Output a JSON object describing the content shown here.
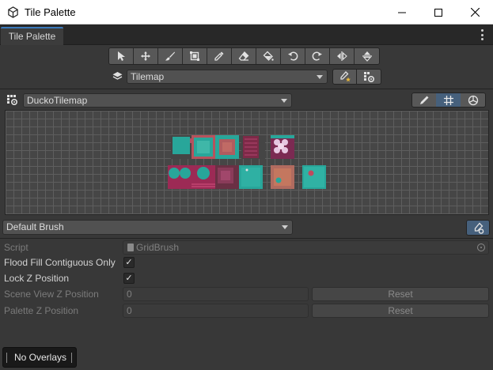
{
  "window": {
    "title": "Tile Palette"
  },
  "tab": {
    "label": "Tile Palette"
  },
  "tools": [
    "select-icon",
    "move-icon",
    "paintbrush-icon",
    "box-fill-icon",
    "picker-icon",
    "eraser-icon",
    "fill-bucket-icon",
    "rotate-ccw-icon",
    "rotate-cw-icon",
    "flip-x-icon",
    "flip-y-icon"
  ],
  "active_target": {
    "selected": "Tilemap"
  },
  "palette": {
    "selected": "DuckoTilemap"
  },
  "brush": {
    "selected": "Default Brush"
  },
  "properties": {
    "script_label": "Script",
    "script_value": "GridBrush",
    "flood_fill_label": "Flood Fill Contiguous Only",
    "flood_fill_checked": "✓",
    "lock_z_label": "Lock Z Position",
    "lock_z_checked": "✓",
    "scene_view_z_label": "Scene View Z Position",
    "scene_view_z_value": "0",
    "palette_z_label": "Palette Z Position",
    "palette_z_value": "0",
    "reset_label": "Reset"
  },
  "overlays": {
    "label": "No Overlays"
  },
  "colors": {
    "accent": "#3a79bb",
    "teal_tile": "#27a59b",
    "rose_tile": "#a0465c"
  }
}
